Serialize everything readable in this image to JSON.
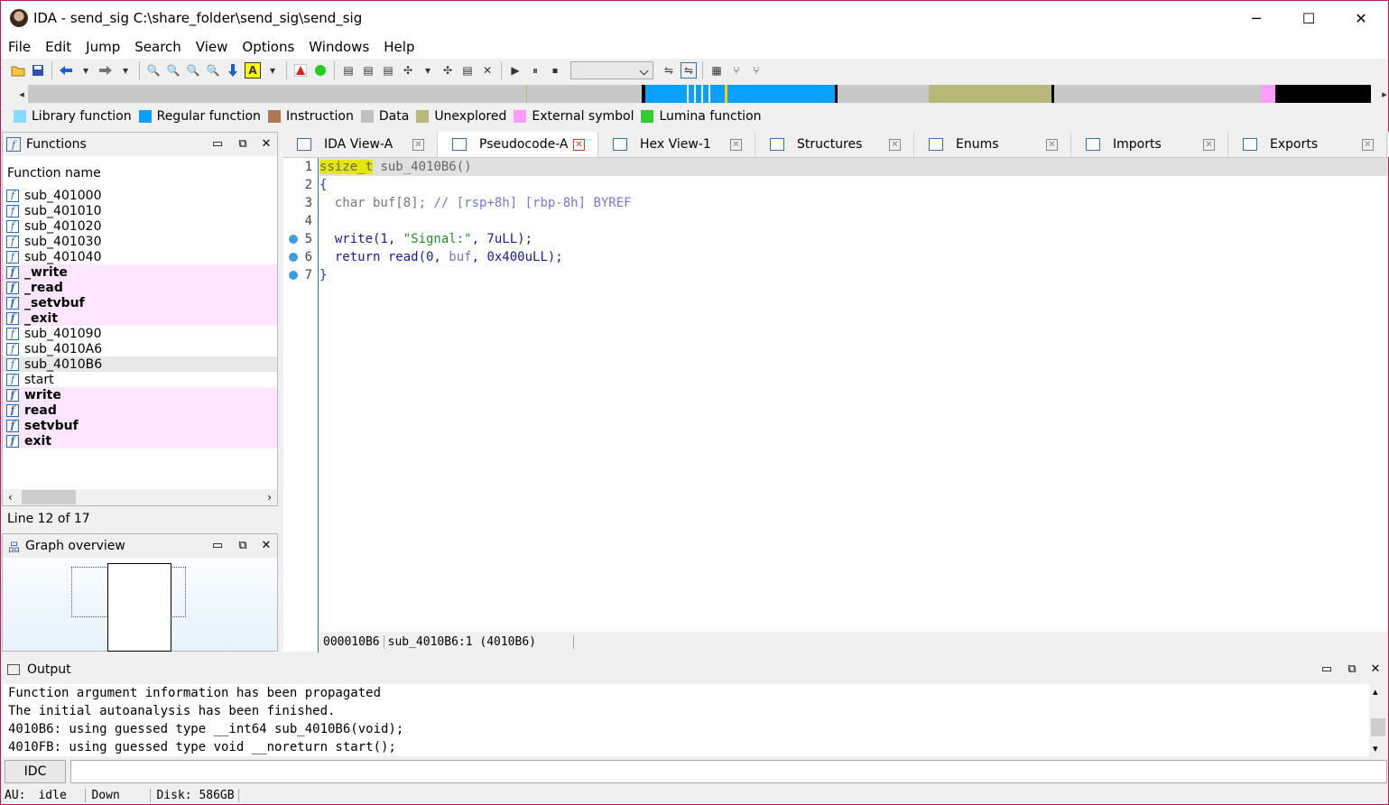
{
  "window": {
    "title": "IDA - send_sig C:\\share_folder\\send_sig\\send_sig",
    "minimize": "─",
    "maximize": "☐",
    "close": "✕"
  },
  "menu": [
    "File",
    "Edit",
    "Jump",
    "Search",
    "View",
    "Options",
    "Windows",
    "Help"
  ],
  "legend": [
    {
      "label": "Library function",
      "color": "#8df"
    },
    {
      "label": "Regular function",
      "color": "#0aa0ff"
    },
    {
      "label": "Instruction",
      "color": "#b07850"
    },
    {
      "label": "Data",
      "color": "#c0c0c0"
    },
    {
      "label": "Unexplored",
      "color": "#b8b878"
    },
    {
      "label": "External symbol",
      "color": "#ff9cff"
    },
    {
      "label": "Lumina function",
      "color": "#3c3"
    }
  ],
  "functions_panel": {
    "title": "Functions",
    "column": "Function name",
    "items": [
      {
        "name": "sub_401000",
        "style": "normal"
      },
      {
        "name": "sub_401010",
        "style": "normal"
      },
      {
        "name": "sub_401020",
        "style": "normal"
      },
      {
        "name": "sub_401030",
        "style": "normal"
      },
      {
        "name": "sub_401040",
        "style": "normal"
      },
      {
        "name": "_write",
        "style": "extern"
      },
      {
        "name": "_read",
        "style": "extern"
      },
      {
        "name": "_setvbuf",
        "style": "extern"
      },
      {
        "name": "_exit",
        "style": "extern"
      },
      {
        "name": "sub_401090",
        "style": "normal"
      },
      {
        "name": "sub_4010A6",
        "style": "normal"
      },
      {
        "name": "sub_4010B6",
        "style": "selected"
      },
      {
        "name": "start",
        "style": "normal"
      },
      {
        "name": "write",
        "style": "extern"
      },
      {
        "name": "read",
        "style": "extern"
      },
      {
        "name": "setvbuf",
        "style": "extern"
      },
      {
        "name": "exit",
        "style": "extern"
      }
    ],
    "status": "Line 12 of 17"
  },
  "graph_panel": {
    "title": "Graph overview"
  },
  "tabs": [
    {
      "label": "IDA View-A",
      "active": false
    },
    {
      "label": "Pseudocode-A",
      "active": true
    },
    {
      "label": "Hex View-1",
      "active": false
    },
    {
      "label": "Structures",
      "active": false
    },
    {
      "label": "Enums",
      "active": false
    },
    {
      "label": "Imports",
      "active": false
    },
    {
      "label": "Exports",
      "active": false
    }
  ],
  "pseudocode": {
    "lines": [
      {
        "n": "1",
        "bp": false
      },
      {
        "n": "2",
        "bp": false
      },
      {
        "n": "3",
        "bp": false
      },
      {
        "n": "4",
        "bp": false
      },
      {
        "n": "5",
        "bp": true
      },
      {
        "n": "6",
        "bp": true
      },
      {
        "n": "7",
        "bp": true
      }
    ],
    "l1_type": "ssize_t",
    "l1_rest": " sub_4010B6()",
    "l2": "{",
    "l3_a": "  char buf[8]; ",
    "l3_b": "// [rsp+8h] [rbp-8h] BYREF",
    "l5_a": "  write(1, ",
    "l5_s": "\"Signal:\"",
    "l5_b": ", 7uLL);",
    "l6_a": "  return read(0, ",
    "l6_v": "buf",
    "l6_b": ", 0x400uLL);",
    "l7": "}",
    "status": [
      "000010B6",
      "sub_4010B6:1 (4010B6)"
    ]
  },
  "output": {
    "title": "Output",
    "lines": [
      "Function argument information has been propagated",
      "The initial autoanalysis has been finished.",
      "4010B6: using guessed type __int64 sub_4010B6(void);",
      "4010FB: using guessed type void __noreturn start();"
    ],
    "idc_label": "IDC"
  },
  "status_bar": {
    "au": "AU:",
    "state": "idle",
    "dir": "Down",
    "disk": "Disk: 586GB"
  }
}
